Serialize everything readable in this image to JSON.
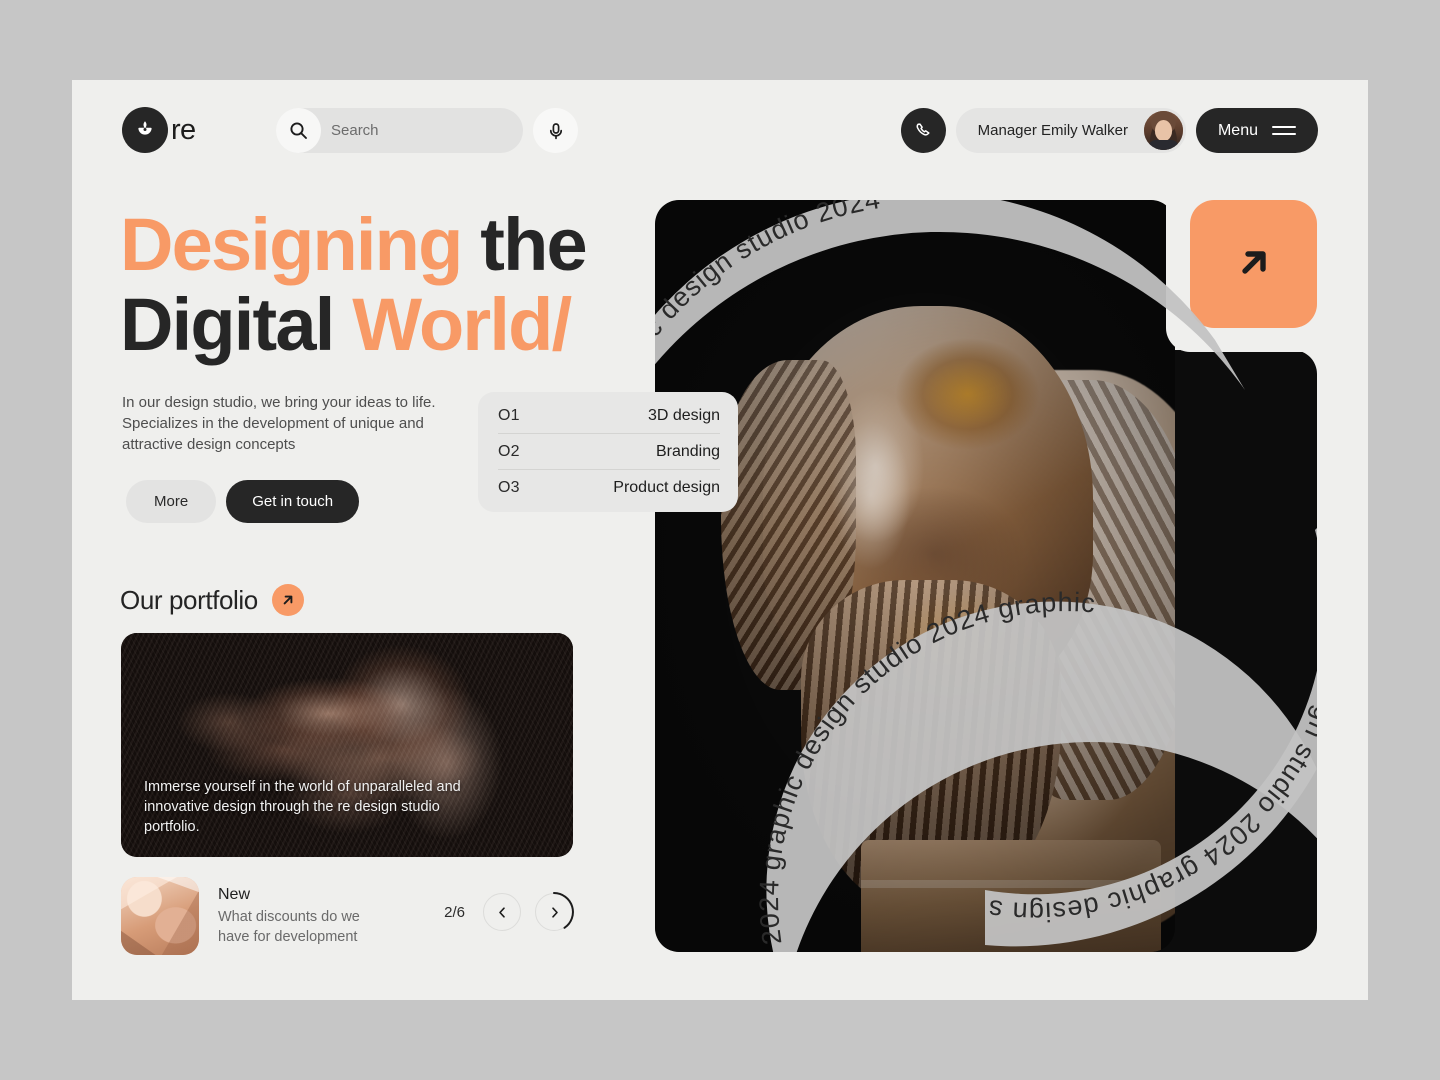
{
  "brand": {
    "name": "re",
    "logo_icon": "lotus-logo-icon"
  },
  "search": {
    "placeholder": "Search",
    "value": "",
    "search_icon": "search-icon",
    "mic_icon": "microphone-icon"
  },
  "header": {
    "phone_icon": "phone-icon",
    "manager_label": "Manager Emily Walker",
    "avatar_alt": "avatar",
    "menu_label": "Menu",
    "menu_icon": "hamburger-icon"
  },
  "hero": {
    "title_line1_accent": "Designing",
    "title_line1_rest": "the",
    "title_line2_rest": "Digital",
    "title_line2_accent": "World/",
    "description": "In our design studio, we bring your ideas to life. Specializes in the development of unique and attractive design concepts",
    "btn_more": "More",
    "btn_contact": "Get in touch",
    "cta_arrow_icon": "arrow-up-right-icon"
  },
  "services": [
    {
      "num": "O1",
      "name": "3D design"
    },
    {
      "num": "O2",
      "name": "Branding"
    },
    {
      "num": "O3",
      "name": "Product design"
    }
  ],
  "portfolio": {
    "title": "Our portfolio",
    "arrow_icon": "arrow-up-right-icon",
    "card_copy": "Immerse yourself in the world of unparalleled and innovative design through the re design studio portfolio."
  },
  "news": {
    "label": "New",
    "headline": "What discounts do we have for development",
    "counter": "2/6",
    "prev_icon": "chevron-left-icon",
    "next_icon": "chevron-right-icon"
  },
  "ribbon": {
    "text": "graphic design studio 2024 ",
    "text_alt": "graphic design studio 2024 "
  },
  "colors": {
    "accent": "#f89a66",
    "dark": "#262626",
    "page_bg": "#efefed",
    "outer_bg": "#c6c6c6",
    "panel_black": "#0c0c0c",
    "ribbon_gray": "#bdbdbd"
  }
}
